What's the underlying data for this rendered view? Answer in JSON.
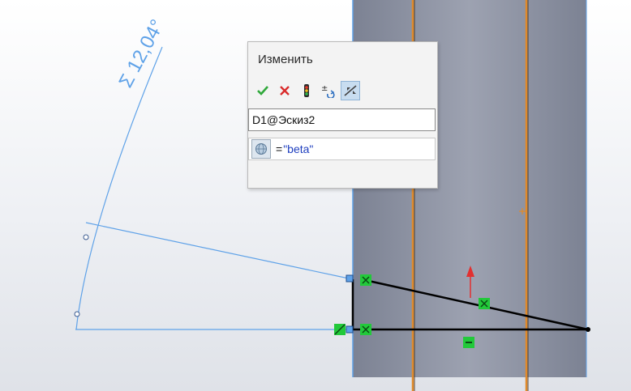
{
  "dialog": {
    "title": "Изменить",
    "toolbar": [
      {
        "name": "ok",
        "icon": "checkmark-icon",
        "color": "#2fa83a"
      },
      {
        "name": "cancel",
        "icon": "cross-icon",
        "color": "#d92b2b"
      },
      {
        "name": "rebuild",
        "icon": "traffic-light-icon"
      },
      {
        "name": "reverse",
        "icon": "plus-minus-reverse-icon"
      },
      {
        "name": "mark-dimension",
        "icon": "dimension-mark-icon",
        "active": true
      }
    ],
    "dimension_name": "D1@Эскиз2",
    "value_eq": "=",
    "value_string": "\"beta\""
  },
  "sketch": {
    "angle_label": "Σ 12,04°",
    "accent_color": "#5fa2e8",
    "line_color": "#000000",
    "relation_color": "#22c93a",
    "centerline_color": "#e08a2a",
    "panel_color": "#8e93a3"
  }
}
